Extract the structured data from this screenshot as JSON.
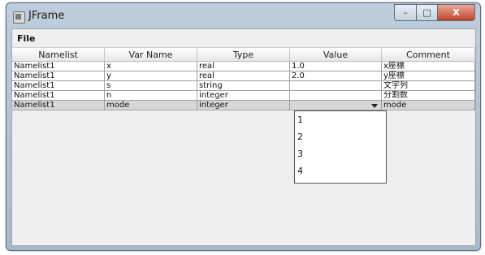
{
  "window": {
    "title": "JFrame",
    "min_glyph": "–",
    "max_glyph": "□",
    "close_glyph": "X"
  },
  "menu": {
    "file": "File"
  },
  "table": {
    "columns": [
      "Namelist",
      "Var Name",
      "Type",
      "Value",
      "Comment"
    ],
    "rows": [
      [
        "Namelist1",
        "x",
        "real",
        "1.0",
        "x座標"
      ],
      [
        "Namelist1",
        "y",
        "real",
        "2.0",
        "y座標"
      ],
      [
        "Namelist1",
        "s",
        "string",
        "",
        "文字列"
      ],
      [
        "Namelist1",
        "n",
        "integer",
        "",
        "分割数"
      ],
      [
        "Namelist1",
        "mode",
        "integer",
        "",
        "mode"
      ]
    ],
    "selected_row": 4
  },
  "dropdown": {
    "options": [
      "1",
      "2",
      "3",
      "4"
    ]
  }
}
